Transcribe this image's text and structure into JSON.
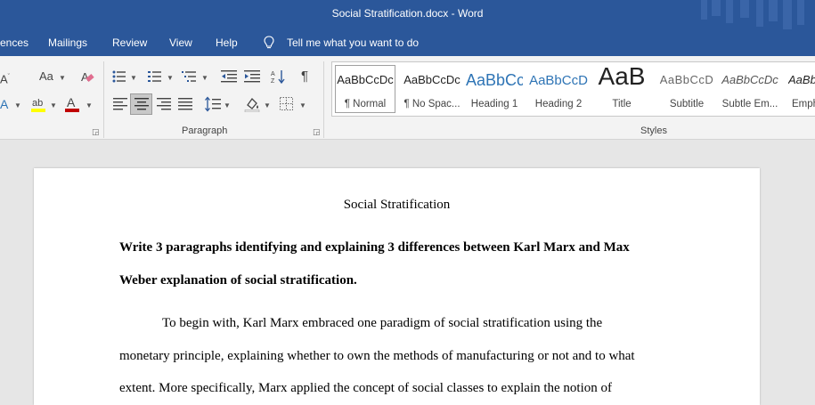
{
  "titlebar": {
    "title": "Social Stratification.docx  -  Word"
  },
  "tabs": {
    "references_partial": "ences",
    "mailings": "Mailings",
    "review": "Review",
    "view": "View",
    "help": "Help",
    "tell_me": "Tell me what you want to do"
  },
  "ribbon": {
    "font_size_case": "Aa",
    "paragraph_label": "Paragraph",
    "styles_label": "Styles",
    "pilcrow": "¶",
    "styles": [
      {
        "sample": "AaBbCcDc",
        "name": "¶ Normal",
        "selected": true
      },
      {
        "sample": "AaBbCcDc",
        "name": "¶ No Spac..."
      },
      {
        "sample": "AaBbCc",
        "name": "Heading 1"
      },
      {
        "sample": "AaBbCcD",
        "name": "Heading 2"
      },
      {
        "sample": "AaB",
        "name": "Title"
      },
      {
        "sample": "AaBbCcD",
        "name": "Subtitle"
      },
      {
        "sample": "AaBbCcDc",
        "name": "Subtle Em..."
      },
      {
        "sample": "AaBb",
        "name": "Emph"
      }
    ]
  },
  "colors": {
    "word_blue": "#2b579a",
    "heading_blue": "#2e74b5",
    "font_color_red": "#c00000",
    "highlight_yellow": "#ffff00"
  },
  "document": {
    "title": "Social Stratification",
    "prompt_line1": "Write 3 paragraphs identifying and explaining 3 differences between Karl Marx and Max",
    "prompt_line2": "Weber explanation of social stratification.",
    "body_line1": "To begin with, Karl Marx embraced one paradigm of social stratification using the",
    "body_line2": "monetary principle, explaining whether to own the methods of manufacturing or not and to what",
    "body_line3": "extent. More specifically, Marx applied the concept of social classes to explain the notion of"
  }
}
